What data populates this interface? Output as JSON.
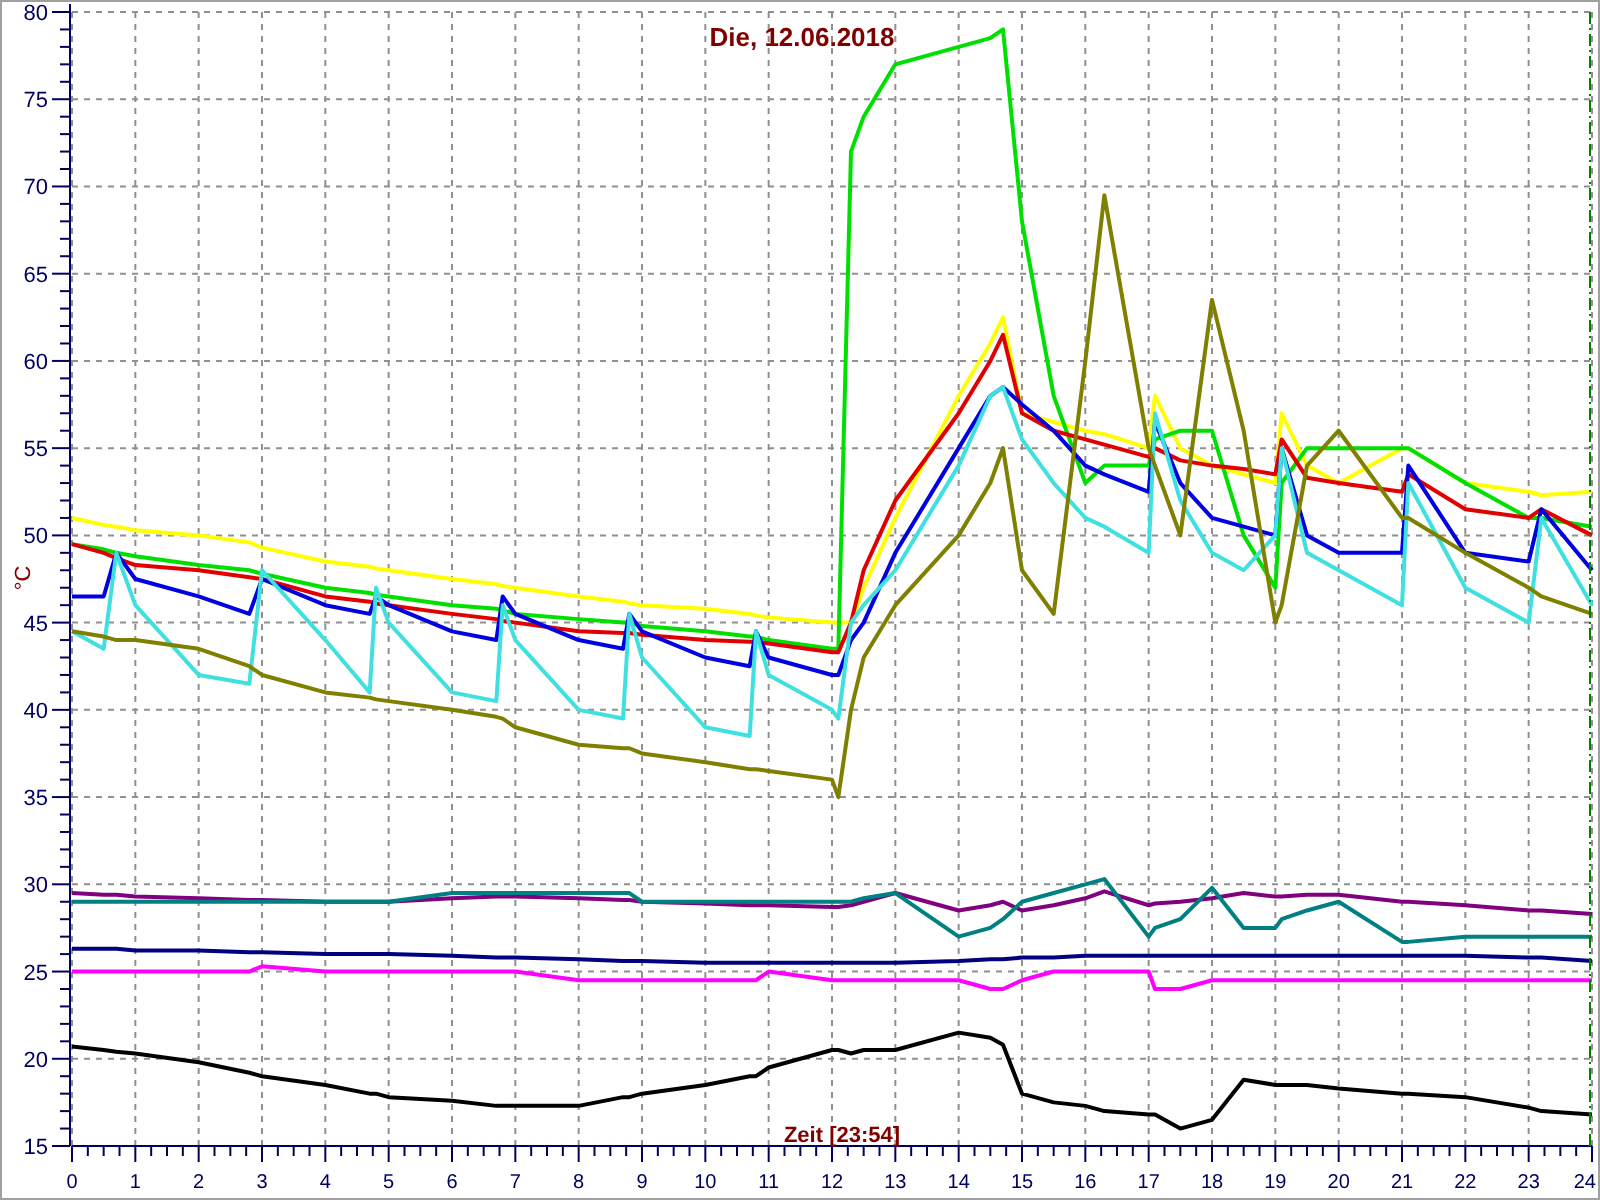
{
  "chart": {
    "chart_data": {
      "type": "line",
      "title": "Die, 12.06.2018",
      "xlabel": "Zeit [23:54]",
      "ylabel": "°C",
      "x": [
        0,
        0.5,
        0.7,
        1,
        2,
        2.8,
        3,
        4,
        4.7,
        4.8,
        5,
        6,
        6.7,
        6.8,
        7,
        8,
        8.7,
        8.8,
        9,
        10,
        10.7,
        10.8,
        11,
        12,
        12.1,
        12.3,
        12.5,
        13,
        14,
        14.5,
        14.7,
        15,
        15.5,
        16,
        16.3,
        17,
        17.1,
        17.5,
        18,
        18.5,
        19,
        19.1,
        19.5,
        20,
        21,
        21.1,
        22,
        23,
        23.2,
        24
      ],
      "series": [
        {
          "color": "#ffff00",
          "values": [
            51,
            50.6,
            50.5,
            50.3,
            50,
            49.6,
            49.3,
            48.5,
            48.2,
            48.1,
            48,
            47.5,
            47.2,
            47.1,
            47,
            46.5,
            46.2,
            46.1,
            46,
            45.8,
            45.5,
            45.4,
            45.3,
            45,
            45,
            45,
            47,
            51,
            58,
            61,
            62.5,
            57,
            56.5,
            56,
            55.8,
            55,
            58,
            55,
            54,
            53.5,
            53,
            57,
            54,
            53,
            55,
            55,
            53,
            52.5,
            52.3,
            52.5
          ]
        },
        {
          "color": "#00e000",
          "values": [
            49.5,
            49.2,
            49,
            48.8,
            48.3,
            48,
            47.8,
            47,
            46.7,
            46.6,
            46.5,
            46,
            45.8,
            45.7,
            45.5,
            45.2,
            45,
            45,
            44.8,
            44.5,
            44.2,
            44.2,
            44,
            43.5,
            43.5,
            72,
            74,
            77,
            78,
            78.5,
            79,
            68,
            58,
            53,
            54,
            54,
            55.5,
            56,
            56,
            50,
            47,
            53,
            55,
            55,
            55,
            55,
            53,
            51,
            51,
            50.5
          ]
        },
        {
          "color": "#e00000",
          "values": [
            49.5,
            49,
            48.7,
            48.3,
            48,
            47.6,
            47.5,
            46.5,
            46.2,
            46.1,
            46,
            45.5,
            45.2,
            45.1,
            45,
            44.5,
            44.4,
            44.4,
            44.3,
            44,
            43.9,
            43.9,
            43.8,
            43.3,
            43.3,
            45,
            48,
            52,
            57,
            60,
            61.5,
            57,
            56,
            55.5,
            55.2,
            54.5,
            55,
            54.3,
            54,
            53.8,
            53.5,
            55.5,
            53.3,
            53,
            52.5,
            53.5,
            51.5,
            51,
            51.5,
            50
          ]
        },
        {
          "color": "#0000e0",
          "values": [
            46.5,
            46.5,
            49,
            47.5,
            46.5,
            45.5,
            47.5,
            46,
            45.5,
            46.5,
            46,
            44.5,
            44,
            46.5,
            45.5,
            44,
            43.5,
            45.5,
            44.5,
            43,
            42.5,
            44.5,
            43,
            42,
            42,
            44,
            45,
            49,
            55,
            58,
            58.5,
            57.5,
            56,
            54,
            53.5,
            52.5,
            56.5,
            53,
            51,
            50.5,
            50,
            55,
            50,
            49,
            49,
            54,
            49,
            48.5,
            51.5,
            48
          ]
        },
        {
          "color": "#40e0e0",
          "values": [
            44.5,
            43.5,
            49,
            46,
            42,
            41.5,
            48,
            44,
            41,
            47,
            45,
            41,
            40.5,
            46,
            44,
            40,
            39.5,
            45.5,
            43,
            39,
            38.5,
            44.5,
            42,
            40,
            39.5,
            45,
            46,
            48,
            54,
            58,
            58.5,
            55.5,
            53,
            51,
            50.5,
            49,
            57,
            52,
            49,
            48,
            50,
            55,
            49,
            48,
            46,
            53,
            47,
            45,
            51,
            46
          ]
        },
        {
          "color": "#808000",
          "values": [
            44.5,
            44.2,
            44,
            44,
            43.5,
            42.5,
            42,
            41,
            40.7,
            40.6,
            40.5,
            40,
            39.6,
            39.5,
            39,
            38,
            37.8,
            37.8,
            37.5,
            37,
            36.6,
            36.6,
            36.5,
            36,
            35,
            40,
            43,
            46,
            50,
            53,
            55,
            48,
            45.5,
            60,
            69.5,
            55,
            54,
            50,
            63.5,
            56,
            45,
            46,
            54,
            56,
            51,
            51,
            49,
            47,
            46.5,
            45.5
          ]
        },
        {
          "color": "#800080",
          "values": [
            29.5,
            29.4,
            29.4,
            29.3,
            29.2,
            29.1,
            29.1,
            29,
            29,
            29,
            29,
            29.2,
            29.3,
            29.3,
            29.3,
            29.2,
            29.1,
            29.1,
            29,
            28.9,
            28.8,
            28.8,
            28.8,
            28.7,
            28.7,
            28.8,
            29,
            29.5,
            28.5,
            28.8,
            29,
            28.5,
            28.8,
            29.2,
            29.6,
            28.8,
            28.9,
            29,
            29.2,
            29.5,
            29.3,
            29.3,
            29.4,
            29.4,
            29,
            29,
            28.8,
            28.5,
            28.5,
            28.3
          ]
        },
        {
          "color": "#008080",
          "values": [
            29,
            29,
            29,
            29,
            29,
            29,
            29,
            29,
            29,
            29,
            29,
            29.5,
            29.5,
            29.5,
            29.5,
            29.5,
            29.5,
            29.5,
            29,
            29,
            29,
            29,
            29,
            29,
            29,
            29,
            29.2,
            29.5,
            27,
            27.5,
            28,
            29,
            29.5,
            30,
            30.3,
            27,
            27.5,
            28,
            29.8,
            27.5,
            27.5,
            28,
            28.5,
            29,
            26.7,
            26.7,
            27,
            27,
            27,
            27
          ]
        },
        {
          "color": "#000080",
          "values": [
            26.3,
            26.3,
            26.3,
            26.2,
            26.2,
            26.1,
            26.1,
            26,
            26,
            26,
            26,
            25.9,
            25.8,
            25.8,
            25.8,
            25.7,
            25.6,
            25.6,
            25.6,
            25.5,
            25.5,
            25.5,
            25.5,
            25.5,
            25.5,
            25.5,
            25.5,
            25.5,
            25.6,
            25.7,
            25.7,
            25.8,
            25.8,
            25.9,
            25.9,
            25.9,
            25.9,
            25.9,
            25.9,
            25.9,
            25.9,
            25.9,
            25.9,
            25.9,
            25.9,
            25.9,
            25.9,
            25.8,
            25.8,
            25.6
          ]
        },
        {
          "color": "#ff00ff",
          "values": [
            25,
            25,
            25,
            25,
            25,
            25,
            25.3,
            25,
            25,
            25,
            25,
            25,
            25,
            25,
            25,
            24.5,
            24.5,
            24.5,
            24.5,
            24.5,
            24.5,
            24.5,
            25,
            24.5,
            24.5,
            24.5,
            24.5,
            24.5,
            24.5,
            24,
            24,
            24.5,
            25,
            25,
            25,
            25,
            24,
            24,
            24.5,
            24.5,
            24.5,
            24.5,
            24.5,
            24.5,
            24.5,
            24.5,
            24.5,
            24.5,
            24.5,
            24.5
          ]
        },
        {
          "color": "#000000",
          "values": [
            20.7,
            20.5,
            20.4,
            20.3,
            19.8,
            19.2,
            19,
            18.5,
            18,
            18,
            17.8,
            17.6,
            17.3,
            17.3,
            17.3,
            17.3,
            17.8,
            17.8,
            18,
            18.5,
            19,
            19,
            19.5,
            20.5,
            20.5,
            20.3,
            20.5,
            20.5,
            21.5,
            21.2,
            20.8,
            18,
            17.5,
            17.3,
            17,
            16.8,
            16.8,
            16,
            16.5,
            18.8,
            18.5,
            18.5,
            18.5,
            18.3,
            18,
            18,
            17.8,
            17.2,
            17,
            16.8
          ]
        }
      ],
      "xlim": [
        0,
        24
      ],
      "ylim": [
        15,
        80
      ],
      "xticks": [
        0,
        1,
        2,
        3,
        4,
        5,
        6,
        7,
        8,
        9,
        10,
        11,
        12,
        13,
        14,
        15,
        16,
        17,
        18,
        19,
        20,
        21,
        22,
        23,
        24
      ],
      "yticks": [
        15,
        20,
        25,
        30,
        35,
        40,
        45,
        50,
        55,
        60,
        65,
        70,
        75,
        80
      ],
      "grid": true
    }
  }
}
